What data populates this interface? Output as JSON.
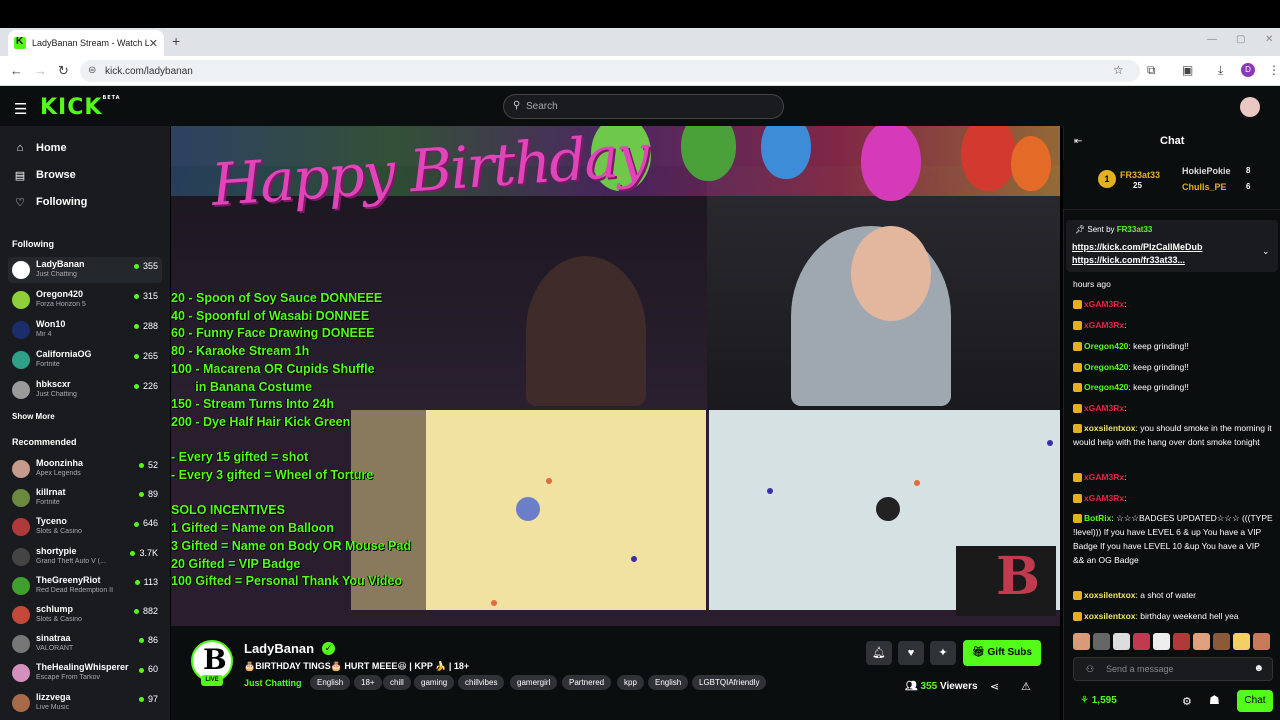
{
  "browser": {
    "tab_title": "LadyBanan Stream - Watch Live",
    "url": "kick.com/ladybanan"
  },
  "header": {
    "logo": "KICK",
    "logo_badge": "BETA",
    "search_placeholder": "Search"
  },
  "sidebar": {
    "nav": [
      {
        "label": "Home",
        "icon": "home-icon"
      },
      {
        "label": "Browse",
        "icon": "browse-icon"
      },
      {
        "label": "Following",
        "icon": "heart-icon"
      }
    ],
    "following_title": "Following",
    "following": [
      {
        "name": "LadyBanan",
        "game": "Just Chatting",
        "viewers": "355",
        "color": "#ffffff"
      },
      {
        "name": "Oregon420",
        "game": "Forza Horizon 5",
        "viewers": "315",
        "color": "#8fcf3b"
      },
      {
        "name": "Won10",
        "game": "Mir 4",
        "viewers": "288",
        "color": "#1c2d6b"
      },
      {
        "name": "CaliforniaOG",
        "game": "Fortnite",
        "viewers": "265",
        "color": "#2ca089"
      },
      {
        "name": "hbkscxr",
        "game": "Just Chatting",
        "viewers": "226",
        "color": "#9a9a9a"
      }
    ],
    "show_more": "Show More",
    "recommended_title": "Recommended",
    "recommended": [
      {
        "name": "Moonzinha",
        "game": "Apex Legends",
        "viewers": "52",
        "color": "#c69a8c"
      },
      {
        "name": "killrnat",
        "game": "Fortnite",
        "viewers": "89",
        "color": "#6c8a3e"
      },
      {
        "name": "Tyceno",
        "game": "Slots & Casino",
        "viewers": "646",
        "color": "#b03a3a"
      },
      {
        "name": "shortypie",
        "game": "Grand Theft Auto V (...",
        "viewers": "3.7K",
        "color": "#444444"
      },
      {
        "name": "TheGreenyRiot",
        "game": "Red Dead Redemption II",
        "viewers": "113",
        "color": "#3fa02f"
      },
      {
        "name": "schlump",
        "game": "Slots & Casino",
        "viewers": "882",
        "color": "#c4493a"
      },
      {
        "name": "sinatraa",
        "game": "VALORANT",
        "viewers": "86",
        "color": "#777777"
      },
      {
        "name": "TheHealingWhisperer",
        "game": "Escape From Tarkov",
        "viewers": "60",
        "color": "#d58fbf"
      },
      {
        "name": "lizzvega",
        "game": "Live Music",
        "viewers": "97",
        "color": "#a86b4a"
      }
    ]
  },
  "video": {
    "overlay_title": "Happy Birthday",
    "incentives": "20 - Spoon of Soy Sauce DONNEEE\n40 - Spoonful of Wasabi DONNEE\n60 - Funny Face Drawing DONEEE\n80 - Karaoke Stream 1h\n100 - Macarena OR Cupids Shuffle\n       in Banana Costume\n150 - Stream Turns Into 24h\n200 - Dye Half Hair Kick Green\n\n- Every 15 gifted = shot\n- Every 3 gifted = Wheel of Torture\n\nSOLO INCENTIVES\n1 Gifted = Name on Balloon\n3 Gifted = Name on Body OR Mouse Pad\n20 Gifted = VIP Badge\n100 Gifted = Personal Thank You Video"
  },
  "channel": {
    "name": "LadyBanan",
    "live": "LIVE",
    "title": "🎂BIRTHDAY TINGS🎂 HURT MEEE😆 | KPP 🍌 | 18+",
    "category": "Just Chatting",
    "tags": [
      "English",
      "18+",
      "chill",
      "gaming",
      "chillvibes",
      "gamergirl",
      "Partnered",
      "kpp",
      "English",
      "LGBTQIAfriendly"
    ],
    "gift_label": "Gift Subs",
    "viewers": "355",
    "viewers_label": "Viewers"
  },
  "chat": {
    "title": "Chat",
    "gifters": [
      {
        "rank": "1",
        "name": "FR33at33",
        "count": "25",
        "color": "#e4b020"
      },
      {
        "name": "HokiePokie",
        "count": "8",
        "color": "#dddddd"
      },
      {
        "name": "Chulls_PE",
        "count": "6",
        "color": "#e4b020"
      }
    ],
    "pinned": {
      "sent_by": "Sent by",
      "user": "FR33at33",
      "links": [
        "https://kick.com/PlzCallMeDub",
        "https://kick.com/fr33at33..."
      ]
    },
    "messages": [
      {
        "user": "",
        "text": "hours ago",
        "color": "#ffffff"
      },
      {
        "user": "xGAM3Rx",
        "text": "",
        "color": "#e0243f"
      },
      {
        "user": "xGAM3Rx",
        "text": "",
        "color": "#e0243f"
      },
      {
        "user": "Oregon420",
        "text": "keep grinding!!",
        "color": "#53fc18"
      },
      {
        "user": "Oregon420",
        "text": "keep grinding!!",
        "color": "#53fc18"
      },
      {
        "user": "Oregon420",
        "text": "keep grinding!!",
        "color": "#53fc18"
      },
      {
        "user": "xGAM3Rx",
        "text": "",
        "color": "#e0243f"
      },
      {
        "user": "xoxsilentxox",
        "text": "you should smoke in the morning it would help with the hang over dont smoke tonight",
        "color": "#f3e36b"
      },
      {
        "user": "xGAM3Rx",
        "text": "",
        "color": "#e0243f"
      },
      {
        "user": "xGAM3Rx",
        "text": "",
        "color": "#e0243f"
      },
      {
        "user": "BotRix",
        "text": "☆☆☆BADGES UPDATED☆☆☆ (((TYPE !level))) If you have LEVEL 6 & up You have a VIP Badge If you have LEVEL 10 &up You have a VIP && an OG Badge",
        "color": "#53fc18"
      },
      {
        "user": "xoxsilentxox",
        "text": "a shot of water",
        "color": "#f3e36b"
      },
      {
        "user": "xoxsilentxox",
        "text": "birthday weekend hell yea",
        "color": "#f3e36b"
      }
    ],
    "send_placeholder": "Send a message",
    "points": "1,595",
    "chat_button": "Chat"
  }
}
